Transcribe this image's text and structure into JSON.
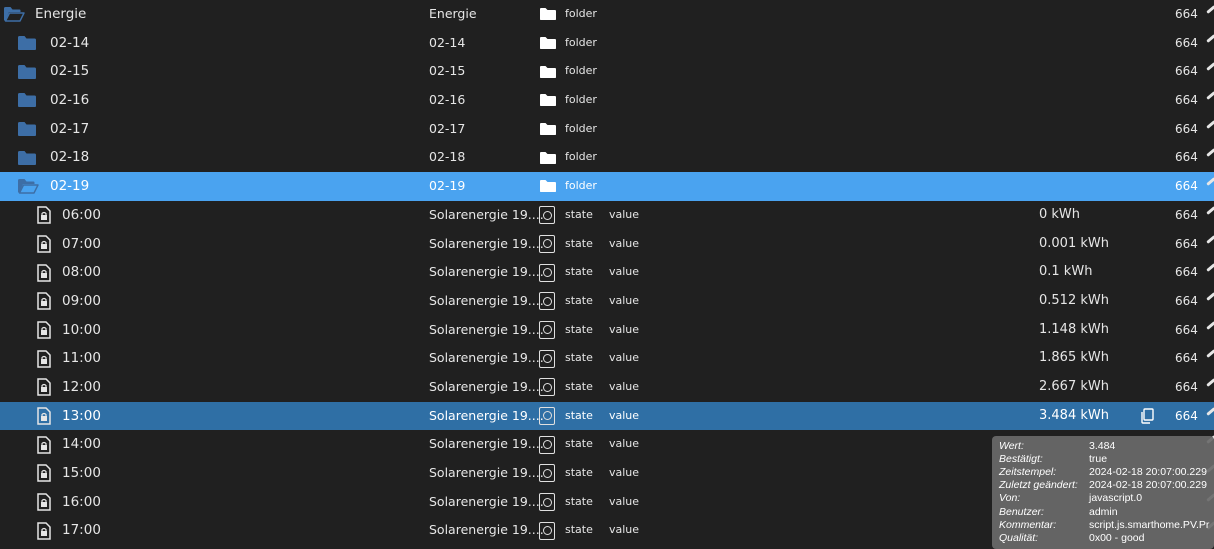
{
  "colors": {
    "background": "#202020",
    "selected_folder_row": "#4aa3f0",
    "selected_state_row": "#2f6fa5",
    "folder_icon": "#3d6ea6",
    "tooltip_bg": "#6a6a6a"
  },
  "rows": [
    {
      "kind": "folder",
      "open": true,
      "name": "Energie",
      "label": "Energie",
      "type": "folder",
      "role": "",
      "value": "",
      "acl": "664",
      "sel": "",
      "indent": 0
    },
    {
      "kind": "folder",
      "open": false,
      "name": "02-14",
      "label": "02-14",
      "type": "folder",
      "role": "",
      "value": "",
      "acl": "664",
      "sel": "",
      "indent": 1
    },
    {
      "kind": "folder",
      "open": false,
      "name": "02-15",
      "label": "02-15",
      "type": "folder",
      "role": "",
      "value": "",
      "acl": "664",
      "sel": "",
      "indent": 1
    },
    {
      "kind": "folder",
      "open": false,
      "name": "02-16",
      "label": "02-16",
      "type": "folder",
      "role": "",
      "value": "",
      "acl": "664",
      "sel": "",
      "indent": 1
    },
    {
      "kind": "folder",
      "open": false,
      "name": "02-17",
      "label": "02-17",
      "type": "folder",
      "role": "",
      "value": "",
      "acl": "664",
      "sel": "",
      "indent": 1
    },
    {
      "kind": "folder",
      "open": false,
      "name": "02-18",
      "label": "02-18",
      "type": "folder",
      "role": "",
      "value": "",
      "acl": "664",
      "sel": "",
      "indent": 1
    },
    {
      "kind": "folder",
      "open": true,
      "name": "02-19",
      "label": "02-19",
      "type": "folder",
      "role": "",
      "value": "",
      "acl": "664",
      "sel": "light",
      "indent": 1
    },
    {
      "kind": "state",
      "name": "06:00",
      "label": "Solarenergie 19....",
      "type": "state",
      "role": "value",
      "value": "0 kWh",
      "acl": "664",
      "sel": "",
      "indent": 2
    },
    {
      "kind": "state",
      "name": "07:00",
      "label": "Solarenergie 19....",
      "type": "state",
      "role": "value",
      "value": "0.001 kWh",
      "acl": "664",
      "sel": "",
      "indent": 2
    },
    {
      "kind": "state",
      "name": "08:00",
      "label": "Solarenergie 19....",
      "type": "state",
      "role": "value",
      "value": "0.1 kWh",
      "acl": "664",
      "sel": "",
      "indent": 2
    },
    {
      "kind": "state",
      "name": "09:00",
      "label": "Solarenergie 19....",
      "type": "state",
      "role": "value",
      "value": "0.512 kWh",
      "acl": "664",
      "sel": "",
      "indent": 2
    },
    {
      "kind": "state",
      "name": "10:00",
      "label": "Solarenergie 19....",
      "type": "state",
      "role": "value",
      "value": "1.148 kWh",
      "acl": "664",
      "sel": "",
      "indent": 2
    },
    {
      "kind": "state",
      "name": "11:00",
      "label": "Solarenergie 19....",
      "type": "state",
      "role": "value",
      "value": "1.865 kWh",
      "acl": "664",
      "sel": "",
      "indent": 2
    },
    {
      "kind": "state",
      "name": "12:00",
      "label": "Solarenergie 19....",
      "type": "state",
      "role": "value",
      "value": "2.667 kWh",
      "acl": "664",
      "sel": "",
      "indent": 2
    },
    {
      "kind": "state",
      "name": "13:00",
      "label": "Solarenergie 19....",
      "type": "state",
      "role": "value",
      "value": "3.484 kWh",
      "acl": "664",
      "sel": "dark",
      "indent": 2,
      "copy": true
    },
    {
      "kind": "state",
      "name": "14:00",
      "label": "Solarenergie 19....",
      "type": "state",
      "role": "value",
      "value": "",
      "acl": "",
      "sel": "",
      "indent": 2
    },
    {
      "kind": "state",
      "name": "15:00",
      "label": "Solarenergie 19....",
      "type": "state",
      "role": "value",
      "value": "",
      "acl": "",
      "sel": "",
      "indent": 2
    },
    {
      "kind": "state",
      "name": "16:00",
      "label": "Solarenergie 19....",
      "type": "state",
      "role": "value",
      "value": "",
      "acl": "",
      "sel": "",
      "indent": 2
    },
    {
      "kind": "state",
      "name": "17:00",
      "label": "Solarenergie 19....",
      "type": "state",
      "role": "value",
      "value": "",
      "acl": "",
      "sel": "",
      "indent": 2
    }
  ],
  "tooltip": {
    "items": [
      {
        "label": "Wert:",
        "value": "3.484"
      },
      {
        "label": "Bestätigt:",
        "value": "true"
      },
      {
        "label": "Zeitstempel:",
        "value": "2024-02-18 20:07:00.229"
      },
      {
        "label": "Zuletzt geändert:",
        "value": "2024-02-18 20:07:00.229"
      },
      {
        "label": "Von:",
        "value": "javascript.0"
      },
      {
        "label": "Benutzer:",
        "value": "admin"
      },
      {
        "label": "Kommentar:",
        "value": "script.js.smarthome.PV.Pr"
      },
      {
        "label": "Qualität:",
        "value": "0x00 - good"
      }
    ]
  }
}
